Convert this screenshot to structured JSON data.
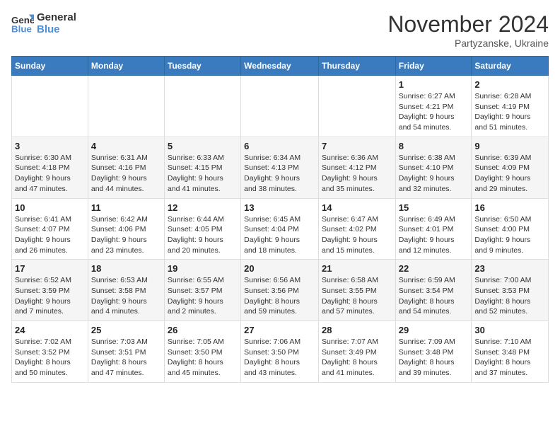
{
  "header": {
    "logo_line1": "General",
    "logo_line2": "Blue",
    "month_title": "November 2024",
    "subtitle": "Partyzanske, Ukraine"
  },
  "columns": [
    "Sunday",
    "Monday",
    "Tuesday",
    "Wednesday",
    "Thursday",
    "Friday",
    "Saturday"
  ],
  "weeks": [
    [
      {
        "day": "",
        "info": ""
      },
      {
        "day": "",
        "info": ""
      },
      {
        "day": "",
        "info": ""
      },
      {
        "day": "",
        "info": ""
      },
      {
        "day": "",
        "info": ""
      },
      {
        "day": "1",
        "info": "Sunrise: 6:27 AM\nSunset: 4:21 PM\nDaylight: 9 hours\nand 54 minutes."
      },
      {
        "day": "2",
        "info": "Sunrise: 6:28 AM\nSunset: 4:19 PM\nDaylight: 9 hours\nand 51 minutes."
      }
    ],
    [
      {
        "day": "3",
        "info": "Sunrise: 6:30 AM\nSunset: 4:18 PM\nDaylight: 9 hours\nand 47 minutes."
      },
      {
        "day": "4",
        "info": "Sunrise: 6:31 AM\nSunset: 4:16 PM\nDaylight: 9 hours\nand 44 minutes."
      },
      {
        "day": "5",
        "info": "Sunrise: 6:33 AM\nSunset: 4:15 PM\nDaylight: 9 hours\nand 41 minutes."
      },
      {
        "day": "6",
        "info": "Sunrise: 6:34 AM\nSunset: 4:13 PM\nDaylight: 9 hours\nand 38 minutes."
      },
      {
        "day": "7",
        "info": "Sunrise: 6:36 AM\nSunset: 4:12 PM\nDaylight: 9 hours\nand 35 minutes."
      },
      {
        "day": "8",
        "info": "Sunrise: 6:38 AM\nSunset: 4:10 PM\nDaylight: 9 hours\nand 32 minutes."
      },
      {
        "day": "9",
        "info": "Sunrise: 6:39 AM\nSunset: 4:09 PM\nDaylight: 9 hours\nand 29 minutes."
      }
    ],
    [
      {
        "day": "10",
        "info": "Sunrise: 6:41 AM\nSunset: 4:07 PM\nDaylight: 9 hours\nand 26 minutes."
      },
      {
        "day": "11",
        "info": "Sunrise: 6:42 AM\nSunset: 4:06 PM\nDaylight: 9 hours\nand 23 minutes."
      },
      {
        "day": "12",
        "info": "Sunrise: 6:44 AM\nSunset: 4:05 PM\nDaylight: 9 hours\nand 20 minutes."
      },
      {
        "day": "13",
        "info": "Sunrise: 6:45 AM\nSunset: 4:04 PM\nDaylight: 9 hours\nand 18 minutes."
      },
      {
        "day": "14",
        "info": "Sunrise: 6:47 AM\nSunset: 4:02 PM\nDaylight: 9 hours\nand 15 minutes."
      },
      {
        "day": "15",
        "info": "Sunrise: 6:49 AM\nSunset: 4:01 PM\nDaylight: 9 hours\nand 12 minutes."
      },
      {
        "day": "16",
        "info": "Sunrise: 6:50 AM\nSunset: 4:00 PM\nDaylight: 9 hours\nand 9 minutes."
      }
    ],
    [
      {
        "day": "17",
        "info": "Sunrise: 6:52 AM\nSunset: 3:59 PM\nDaylight: 9 hours\nand 7 minutes."
      },
      {
        "day": "18",
        "info": "Sunrise: 6:53 AM\nSunset: 3:58 PM\nDaylight: 9 hours\nand 4 minutes."
      },
      {
        "day": "19",
        "info": "Sunrise: 6:55 AM\nSunset: 3:57 PM\nDaylight: 9 hours\nand 2 minutes."
      },
      {
        "day": "20",
        "info": "Sunrise: 6:56 AM\nSunset: 3:56 PM\nDaylight: 8 hours\nand 59 minutes."
      },
      {
        "day": "21",
        "info": "Sunrise: 6:58 AM\nSunset: 3:55 PM\nDaylight: 8 hours\nand 57 minutes."
      },
      {
        "day": "22",
        "info": "Sunrise: 6:59 AM\nSunset: 3:54 PM\nDaylight: 8 hours\nand 54 minutes."
      },
      {
        "day": "23",
        "info": "Sunrise: 7:00 AM\nSunset: 3:53 PM\nDaylight: 8 hours\nand 52 minutes."
      }
    ],
    [
      {
        "day": "24",
        "info": "Sunrise: 7:02 AM\nSunset: 3:52 PM\nDaylight: 8 hours\nand 50 minutes."
      },
      {
        "day": "25",
        "info": "Sunrise: 7:03 AM\nSunset: 3:51 PM\nDaylight: 8 hours\nand 47 minutes."
      },
      {
        "day": "26",
        "info": "Sunrise: 7:05 AM\nSunset: 3:50 PM\nDaylight: 8 hours\nand 45 minutes."
      },
      {
        "day": "27",
        "info": "Sunrise: 7:06 AM\nSunset: 3:50 PM\nDaylight: 8 hours\nand 43 minutes."
      },
      {
        "day": "28",
        "info": "Sunrise: 7:07 AM\nSunset: 3:49 PM\nDaylight: 8 hours\nand 41 minutes."
      },
      {
        "day": "29",
        "info": "Sunrise: 7:09 AM\nSunset: 3:48 PM\nDaylight: 8 hours\nand 39 minutes."
      },
      {
        "day": "30",
        "info": "Sunrise: 7:10 AM\nSunset: 3:48 PM\nDaylight: 8 hours\nand 37 minutes."
      }
    ]
  ]
}
